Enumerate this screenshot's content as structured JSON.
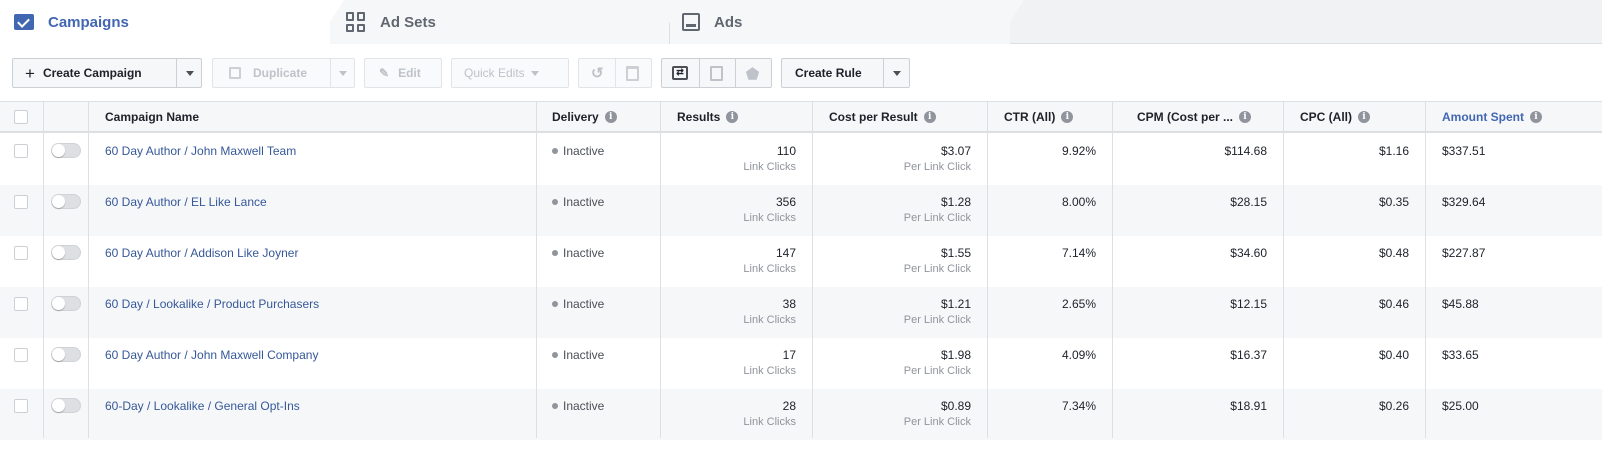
{
  "tabs": [
    {
      "label": "Campaigns",
      "icon": "checkbox-icon",
      "active": true
    },
    {
      "label": "Ad Sets",
      "icon": "grid-icon",
      "active": false
    },
    {
      "label": "Ads",
      "icon": "ad-preview-icon",
      "active": false
    }
  ],
  "toolbar": {
    "create_label": "Create Campaign",
    "duplicate_label": "Duplicate",
    "edit_label": "Edit",
    "quick_edits_label": "Quick Edits",
    "create_rule_label": "Create Rule"
  },
  "table": {
    "headers": {
      "name": "Campaign Name",
      "delivery": "Delivery",
      "results": "Results",
      "cost_per_result": "Cost per Result",
      "ctr": "CTR (All)",
      "cpm": "CPM (Cost per ...",
      "cpc": "CPC (All)",
      "amount_spent": "Amount Spent"
    },
    "rows": [
      {
        "name": "60 Day Author / John Maxwell Team",
        "delivery": "Inactive",
        "results": "110",
        "results_sub": "Link Clicks",
        "cost": "$3.07",
        "cost_sub": "Per Link Click",
        "ctr": "9.92%",
        "cpm": "$114.68",
        "cpc": "$1.16",
        "spent": "$337.51"
      },
      {
        "name": "60 Day Author / EL Like Lance",
        "delivery": "Inactive",
        "results": "356",
        "results_sub": "Link Clicks",
        "cost": "$1.28",
        "cost_sub": "Per Link Click",
        "ctr": "8.00%",
        "cpm": "$28.15",
        "cpc": "$0.35",
        "spent": "$329.64"
      },
      {
        "name": "60 Day Author / Addison Like Joyner",
        "delivery": "Inactive",
        "results": "147",
        "results_sub": "Link Clicks",
        "cost": "$1.55",
        "cost_sub": "Per Link Click",
        "ctr": "7.14%",
        "cpm": "$34.60",
        "cpc": "$0.48",
        "spent": "$227.87"
      },
      {
        "name": "60 Day / Lookalike / Product Purchasers",
        "delivery": "Inactive",
        "results": "38",
        "results_sub": "Link Clicks",
        "cost": "$1.21",
        "cost_sub": "Per Link Click",
        "ctr": "2.65%",
        "cpm": "$12.15",
        "cpc": "$0.46",
        "spent": "$45.88"
      },
      {
        "name": "60 Day Author / John Maxwell Company",
        "delivery": "Inactive",
        "results": "17",
        "results_sub": "Link Clicks",
        "cost": "$1.98",
        "cost_sub": "Per Link Click",
        "ctr": "4.09%",
        "cpm": "$16.37",
        "cpc": "$0.40",
        "spent": "$33.65"
      },
      {
        "name": "60-Day / Lookalike / General Opt-Ins",
        "delivery": "Inactive",
        "results": "28",
        "results_sub": "Link Clicks",
        "cost": "$0.89",
        "cost_sub": "Per Link Click",
        "ctr": "7.34%",
        "cpm": "$18.91",
        "cpc": "$0.26",
        "spent": "$25.00"
      }
    ]
  },
  "colors": {
    "accent": "#4267b2",
    "link": "#365899",
    "muted": "#90949c"
  }
}
